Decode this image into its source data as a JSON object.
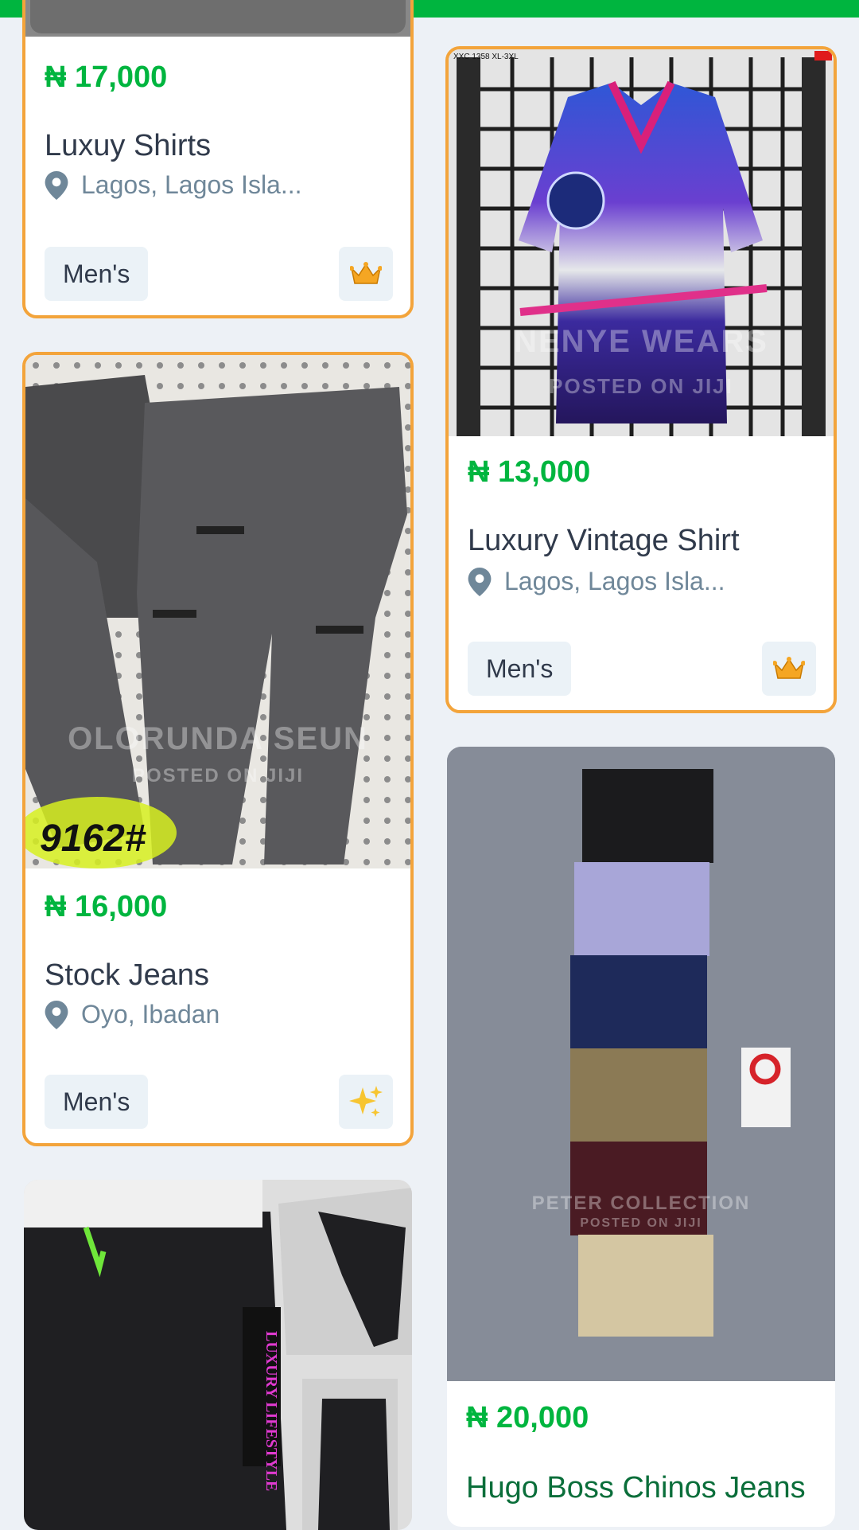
{
  "listings": [
    {
      "price": "₦ 17,000",
      "title": "Luxuy Shirts",
      "location": "Lagos, Lagos Isla...",
      "category": "Men's",
      "badge_icon": "crown-icon"
    },
    {
      "price": "₦ 13,000",
      "title": "Luxury Vintage Shirt",
      "location": "Lagos, Lagos Isla...",
      "category": "Men's",
      "badge_icon": "crown-icon",
      "image_label": "XXC 1358 XL-3XL",
      "watermark": "NENYE WEARS",
      "watermark_sub": "POSTED ON JIJI"
    },
    {
      "price": "₦ 16,000",
      "title": "Stock Jeans",
      "location": "Oyo, Ibadan",
      "category": "Men's",
      "badge_icon": "sparkles-icon",
      "image_code": "9162#",
      "watermark": "OLORUNDA SEUN",
      "watermark_sub": "POSTED ON JIJI"
    },
    {
      "price": "₦ 20,000",
      "title": "Hugo Boss Chinos Jeans",
      "watermark": "PETER COLLECTION",
      "watermark_sub": "POSTED ON JIJI"
    },
    {
      "image_text": "LUXURY LIFESTYLE"
    }
  ],
  "colors": {
    "brand_green": "#00b53f",
    "boost_border": "#f3a43b",
    "text": "#303a4b",
    "muted": "#6f8799"
  }
}
